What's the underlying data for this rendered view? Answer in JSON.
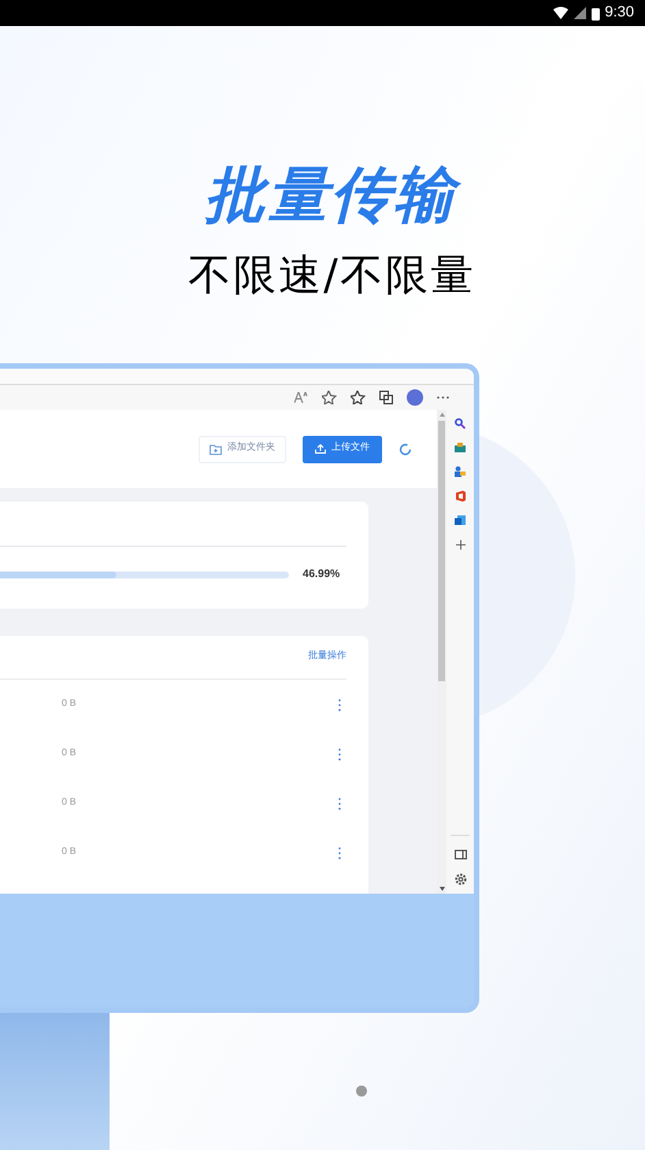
{
  "status_bar": {
    "time": "9:30"
  },
  "headline": "批量传输",
  "subheadline": "不限速/不限量",
  "browser": {
    "buttons": [
      {
        "kind": "outline",
        "label": "添加文件夹"
      },
      {
        "kind": "primary",
        "label": "上传文件"
      }
    ],
    "progress": {
      "level": 0.47,
      "reading": "46.99%"
    },
    "files": {
      "action": "批量操作",
      "rows": [
        {
          "size": "0 B"
        },
        {
          "size": "0 B"
        },
        {
          "size": "0 B"
        },
        {
          "size": "0 B"
        }
      ]
    }
  },
  "page_indicator": [
    {
      "selected": true
    }
  ]
}
